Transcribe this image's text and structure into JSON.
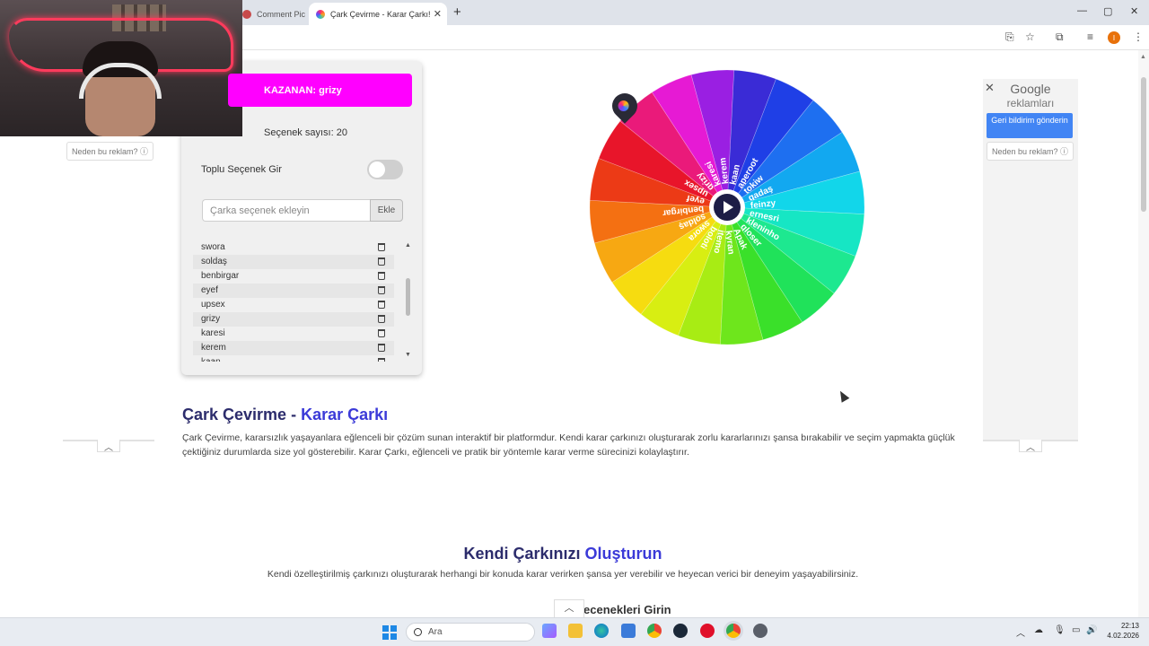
{
  "browser": {
    "tabs": [
      {
        "label": "Comment Pic",
        "active": false
      },
      {
        "label": "Çark Çevirme - Karar Çarkı!",
        "active": true
      }
    ],
    "new_tab": "+",
    "window_controls": [
      "—",
      "▢",
      "✕"
    ]
  },
  "game": {
    "winner_label": "KAZANAN: grizy",
    "option_count": "Seçenek sayısı: 20",
    "bulk_toggle_label": "Toplu Seçenek Gir",
    "bulk_toggle_on": false,
    "input_placeholder": "Çarka seçenek ekleyin",
    "add_button": "Ekle",
    "options": [
      "swora",
      "soldaş",
      "benbirgar",
      "eyef",
      "upsex",
      "grizy",
      "karesi",
      "kerem",
      "kaan"
    ]
  },
  "wheel": {
    "segments": [
      {
        "label": "kaan",
        "color": "#3a2bd6"
      },
      {
        "label": "aperoot",
        "color": "#1f3fe6"
      },
      {
        "label": "tokiw",
        "color": "#1e6ff0"
      },
      {
        "label": "gadaş",
        "color": "#12a8f0"
      },
      {
        "label": "feinzy",
        "color": "#12d6ea"
      },
      {
        "label": "ernesri",
        "color": "#16e6c4"
      },
      {
        "label": "kleninho",
        "color": "#1de890"
      },
      {
        "label": "gloser",
        "color": "#20e25a"
      },
      {
        "label": "Apak",
        "color": "#3ae02a"
      },
      {
        "label": "kyran",
        "color": "#6ee61c"
      },
      {
        "label": "jtemo",
        "color": "#a8ec14"
      },
      {
        "label": "boloti",
        "color": "#d8ee12"
      },
      {
        "label": "swora",
        "color": "#f6dc10"
      },
      {
        "label": "soldaş",
        "color": "#f7a812"
      },
      {
        "label": "benbirgar",
        "color": "#f47012"
      },
      {
        "label": "eyef",
        "color": "#ec3a16"
      },
      {
        "label": "upsex",
        "color": "#e8152a"
      },
      {
        "label": "grizy",
        "color": "#ea1a7a"
      },
      {
        "label": "karesi",
        "color": "#e61ad4"
      },
      {
        "label": "kerem",
        "color": "#9a1fe2"
      }
    ],
    "spin_icon": "play-icon"
  },
  "ads": {
    "why_ad": "Neden bu reklam? ⓘ",
    "google": "Google",
    "ads_word": "reklamları",
    "feedback": "Geri bildirim gönderin"
  },
  "content": {
    "title_part1": "Çark Çevirme - ",
    "title_part2": "Karar Çarkı",
    "description": "Çark Çevirme, kararsızlık yaşayanlara eğlenceli bir çözüm sunan interaktif bir platformdur. Kendi karar çarkınızı oluşturarak zorlu kararlarınızı şansa bırakabilir ve seçim yapmakta güçlük çektiğiniz durumlarda size yol gösterebilir. Karar Çarkı, eğlenceli ve pratik bir yöntemle karar verme sürecinizi kolaylaştırır.",
    "create_title_part1": "Kendi Çarkınızı ",
    "create_title_part2": "Oluşturun",
    "create_description": "Kendi özelleştirilmiş çarkınızı oluşturarak herhangi bir konuda karar verirken şansa yer verebilir ve heyecan verici bir deneyim yaşayabilirsiniz.",
    "next_heading": "ecenekleri Girin"
  },
  "taskbar": {
    "search_placeholder": "Ara",
    "time": "22:13",
    "date": "4.02.2026"
  },
  "colors": {
    "winner_bg": "#ff00ff",
    "heading": "#2c2c6c",
    "accent": "#3b3ad8"
  }
}
